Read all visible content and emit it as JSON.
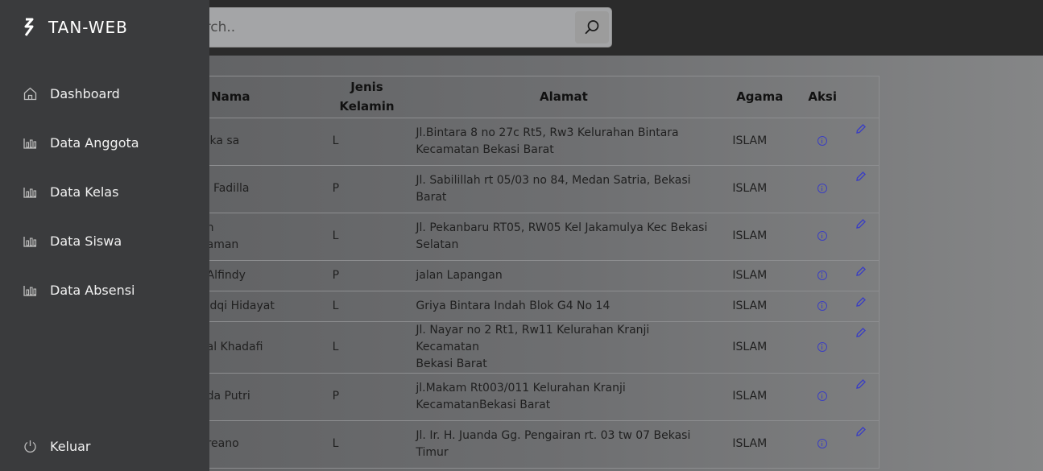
{
  "search": {
    "placeholder": "Search.."
  },
  "brand": {
    "name": "TAN-WEB"
  },
  "sidebar": {
    "items": [
      {
        "label": "Dashboard",
        "icon": "home-icon"
      },
      {
        "label": "Data Anggota",
        "icon": "bar-chart-icon"
      },
      {
        "label": "Data Kelas",
        "icon": "bar-chart-icon"
      },
      {
        "label": "Data Siswa",
        "icon": "bar-chart-icon"
      },
      {
        "label": "Data Absensi",
        "icon": "bar-chart-icon"
      }
    ],
    "logout": {
      "label": "Keluar",
      "icon": "power-icon"
    }
  },
  "table": {
    "headers": {
      "nama": "Nama",
      "jenis_kelamin_1": "Jenis",
      "jenis_kelamin_2": "Kelamin",
      "alamat": "Alamat",
      "agama": "Agama",
      "aksi": "Aksi"
    },
    "rows": [
      {
        "nama_1": "ika sa",
        "nama_2": "",
        "jk": "L",
        "alamat_1": "Jl.Bintara 8 no 27c Rt5, Rw3 Kelurahan Bintara",
        "alamat_2": "Kecamatan Bekasi Barat",
        "agama": "ISLAM"
      },
      {
        "nama_1": "i Fadilla",
        "nama_2": "",
        "jk": "P",
        "alamat_1": "Jl. Sabilillah rt 05/03 no 84, Medan Satria, Bekasi",
        "alamat_2": "Barat",
        "agama": "ISLAM"
      },
      {
        "nama_1": "n",
        "nama_2": "aman",
        "jk": "L",
        "alamat_1": "Jl. Pekanbaru RT05, RW05 Kel Jakamulya Kec Bekasi",
        "alamat_2": "Selatan",
        "agama": "ISLAM"
      },
      {
        "nama_1": "Alfindy",
        "nama_2": "",
        "jk": "P",
        "alamat_1": "jalan Lapangan",
        "alamat_2": "",
        "agama": "ISLAM"
      },
      {
        "nama_1": "idqi Hidayat",
        "nama_2": "",
        "jk": "L",
        "alamat_1": "Griya Bintara Indah Blok G4 No 14",
        "alamat_2": "",
        "agama": "ISLAM"
      },
      {
        "nama_1": "al Khadafi",
        "nama_2": "",
        "jk": "L",
        "alamat_1": "Jl. Nayar no 2 Rt1, Rw11 Kelurahan Kranji Kecamatan",
        "alamat_2": "Bekasi Barat",
        "agama": "ISLAM"
      },
      {
        "nama_1": "da Putri",
        "nama_2": "",
        "jk": "P",
        "alamat_1": "jl.Makam Rt003/011 Kelurahan Kranji",
        "alamat_2": "KecamatanBekasi Barat",
        "agama": "ISLAM"
      },
      {
        "nama_1": "reano",
        "nama_2": "",
        "jk": "L",
        "alamat_1": "Jl. Ir. H. Juanda Gg. Pengairan rt. 03 tw 07 Bekasi",
        "alamat_2": "Timur",
        "agama": "ISLAM"
      }
    ]
  },
  "colors": {
    "sidebar": "#3a3b3d",
    "topbar": "#2b2b2b",
    "icon_blue": "#3b3fc2"
  }
}
